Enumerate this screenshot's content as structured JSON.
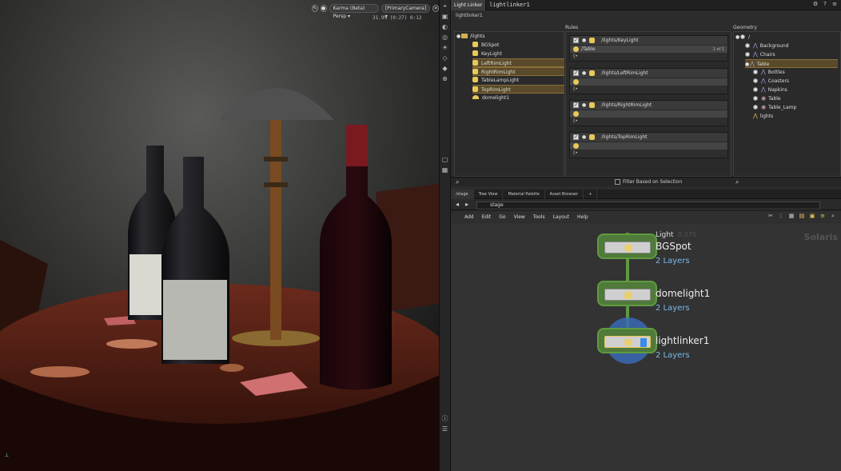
{
  "viewport": {
    "renderer": "Karma (Beta)",
    "view": "Persp",
    "camera": "[PrimaryCamera]",
    "stats_left": "31.9%",
    "stats_mid": "(0:27)",
    "stats_right": "0:12"
  },
  "light_linker": {
    "tab_label": "Light Linker",
    "node_name": "lightlinker1",
    "path_label": "lightlinker1",
    "lights_tree": {
      "root": "/lights",
      "items": [
        {
          "label": "BGSpot",
          "selected": false,
          "icon": "spotlight-icon"
        },
        {
          "label": "KeyLight",
          "selected": false,
          "icon": "spotlight-icon"
        },
        {
          "label": "LeftRimLight",
          "selected": true,
          "icon": "arealight-icon"
        },
        {
          "label": "RightRimLight",
          "selected": true,
          "icon": "arealight-icon"
        },
        {
          "label": "TableLampLight",
          "selected": false,
          "icon": "arealight-icon"
        },
        {
          "label": "TopRimLight",
          "selected": true,
          "icon": "arealight-icon"
        },
        {
          "label": "domelight1",
          "selected": false,
          "icon": "domelight-icon"
        }
      ]
    },
    "rules_header": "Rules",
    "rules": [
      {
        "path": "/lights/KeyLight",
        "target": "/Table",
        "count": "1 of 1"
      },
      {
        "path": "/lights/LeftRimLight",
        "target": "",
        "count": ""
      },
      {
        "path": "/lights/RightRimLight",
        "target": "",
        "count": ""
      },
      {
        "path": "/lights/TopRimLight",
        "target": "",
        "count": ""
      }
    ],
    "geometry_header": "Geometry",
    "geometry": {
      "root": "/",
      "items": [
        {
          "label": "Background",
          "level": 1
        },
        {
          "label": "Chairs",
          "level": 1
        },
        {
          "label": "Table",
          "level": 1,
          "selected": true
        },
        {
          "label": "Bottles",
          "level": 2
        },
        {
          "label": "Coasters",
          "level": 2
        },
        {
          "label": "Napkins",
          "level": 2
        },
        {
          "label": "Table",
          "level": 2
        },
        {
          "label": "Table_Lamp",
          "level": 2
        },
        {
          "label": "lights",
          "level": 1
        }
      ]
    },
    "filter_label": "Filter Based on Selection"
  },
  "network": {
    "tabs": [
      "/stage",
      "Tree View",
      "Material Palette",
      "Asset Browser"
    ],
    "path": "stage",
    "menus": [
      "Add",
      "Edit",
      "Go",
      "View",
      "Tools",
      "Layout",
      "Help"
    ],
    "context_label": "Solaris",
    "nodes": [
      {
        "name": "BGSpot",
        "sub": "2 Layers",
        "overlay": "Light"
      },
      {
        "name": "domelight1",
        "sub": "2 Layers"
      },
      {
        "name": "lightlinker1",
        "sub": "2 Layers"
      }
    ],
    "ghost_text": "0.275"
  }
}
